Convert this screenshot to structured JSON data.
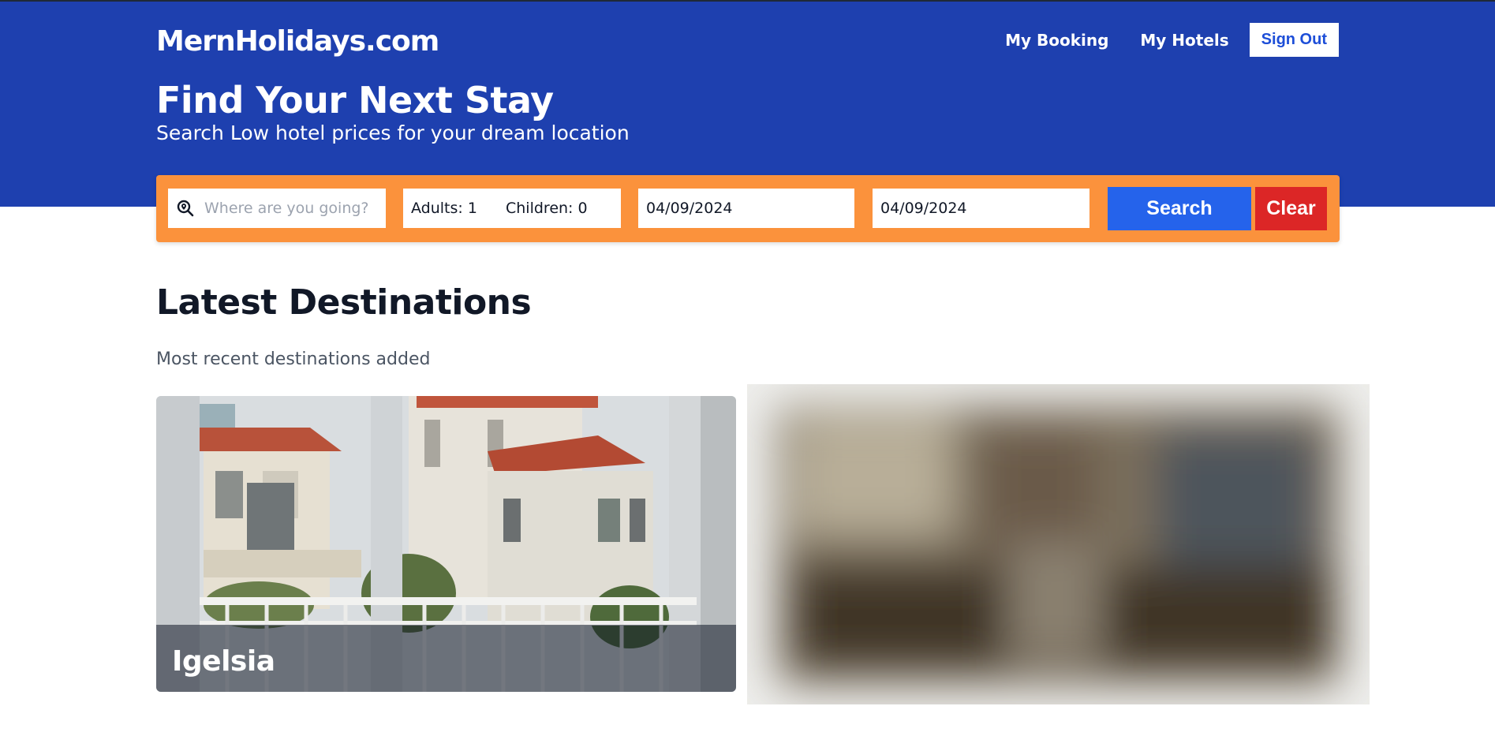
{
  "header": {
    "logo": "MernHolidays.com",
    "nav": {
      "my_booking": "My Booking",
      "my_hotels": "My Hotels",
      "sign_out": "Sign Out"
    }
  },
  "hero": {
    "title": "Find Your Next Stay",
    "subtitle": "Search Low hotel prices for your dream location"
  },
  "search": {
    "destination_placeholder": "Where are you going?",
    "adults_label": "Adults: 1",
    "children_label": "Children: 0",
    "check_in": "04/09/2024",
    "check_out": "04/09/2024",
    "search_label": "Search",
    "clear_label": "Clear"
  },
  "latest": {
    "title": "Latest Destinations",
    "subtitle": "Most recent destinations added",
    "cards": [
      {
        "name": "Igelsia"
      },
      {
        "name": ""
      }
    ]
  },
  "colors": {
    "header_bg": "#1e40af",
    "search_bar_bg": "#fb923c",
    "search_button": "#2563eb",
    "clear_button": "#dc2626",
    "sign_out_text": "#1d4ed8"
  }
}
